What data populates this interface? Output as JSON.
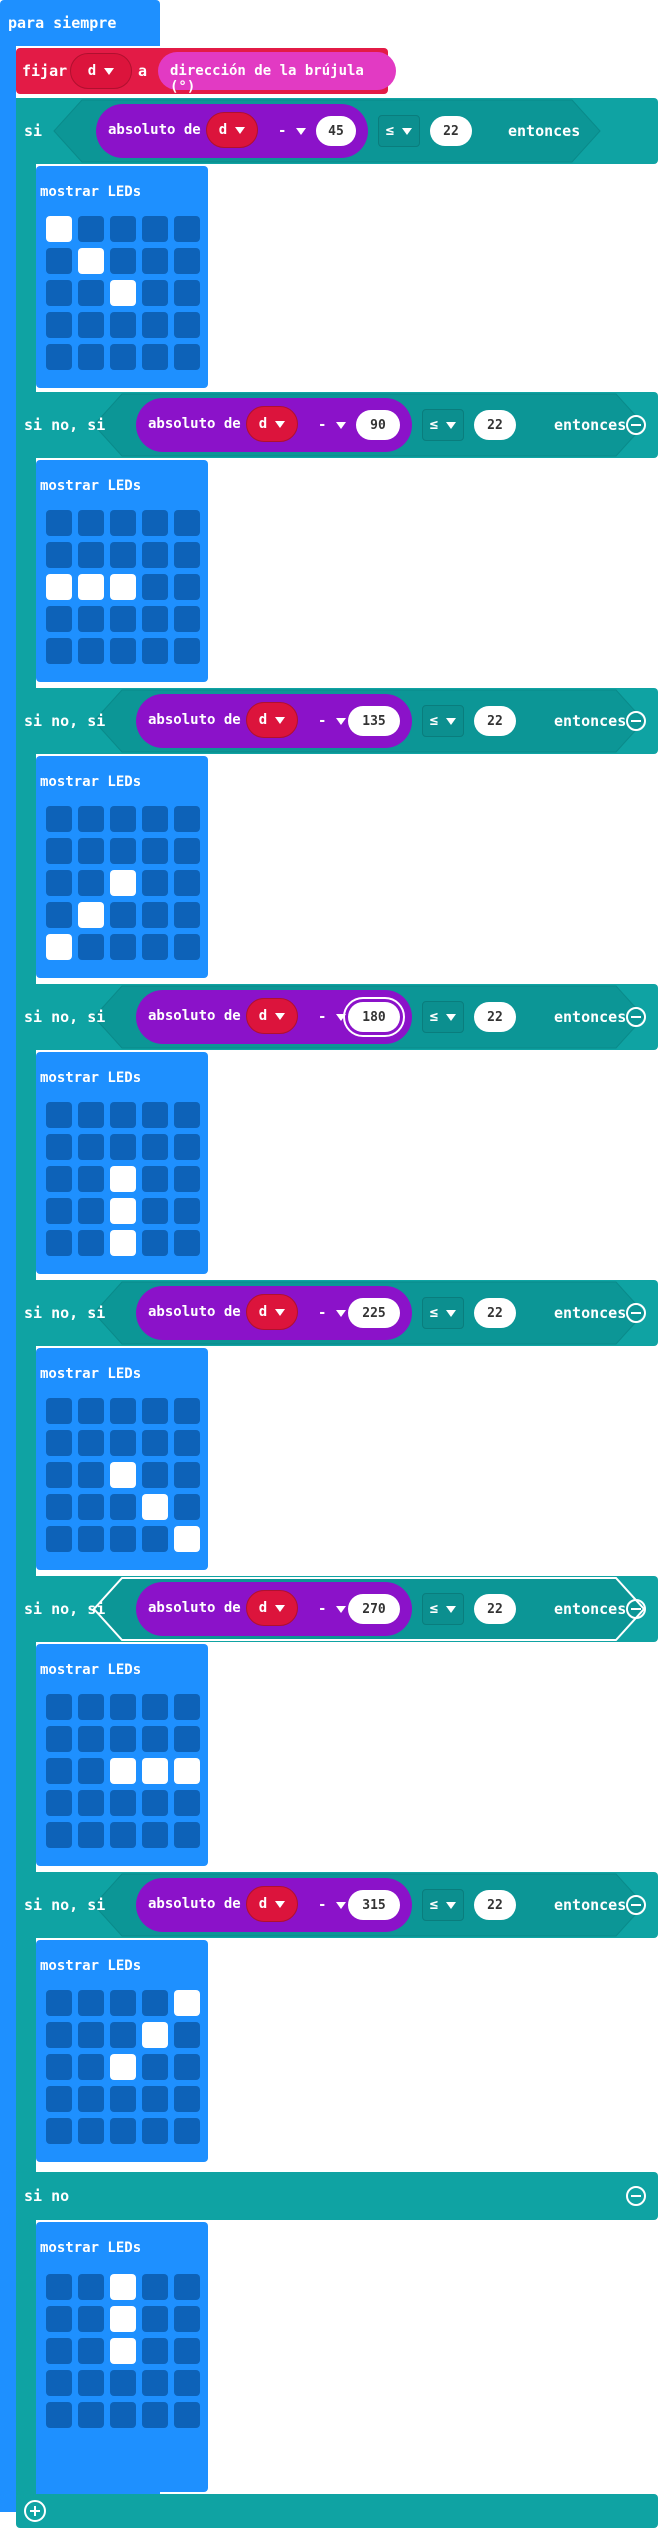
{
  "forever": {
    "label": "para siempre"
  },
  "set_block": {
    "verb": "fijar",
    "variable": "d",
    "to": "a",
    "value": "dirección de la brújula (°)"
  },
  "if_block": {
    "branches": [
      {
        "keyword": "si",
        "abs_label": "absoluto de",
        "variable": "d",
        "op": "-",
        "angle": "45",
        "cmp": "≤",
        "threshold": "22",
        "then": "entonces",
        "led_title": "mostrar LEDs",
        "leds": [
          [
            1,
            0,
            0,
            0,
            0
          ],
          [
            0,
            1,
            0,
            0,
            0
          ],
          [
            0,
            0,
            1,
            0,
            0
          ],
          [
            0,
            0,
            0,
            0,
            0
          ],
          [
            0,
            0,
            0,
            0,
            0
          ]
        ]
      },
      {
        "keyword": "si no, si",
        "abs_label": "absoluto de",
        "variable": "d",
        "op": "-",
        "angle": "90",
        "cmp": "≤",
        "threshold": "22",
        "then": "entonces",
        "led_title": "mostrar LEDs",
        "leds": [
          [
            0,
            0,
            0,
            0,
            0
          ],
          [
            0,
            0,
            0,
            0,
            0
          ],
          [
            1,
            1,
            1,
            0,
            0
          ],
          [
            0,
            0,
            0,
            0,
            0
          ],
          [
            0,
            0,
            0,
            0,
            0
          ]
        ]
      },
      {
        "keyword": "si no, si",
        "abs_label": "absoluto de",
        "variable": "d",
        "op": "-",
        "angle": "135",
        "cmp": "≤",
        "threshold": "22",
        "then": "entonces",
        "led_title": "mostrar LEDs",
        "leds": [
          [
            0,
            0,
            0,
            0,
            0
          ],
          [
            0,
            0,
            0,
            0,
            0
          ],
          [
            0,
            0,
            1,
            0,
            0
          ],
          [
            0,
            1,
            0,
            0,
            0
          ],
          [
            1,
            0,
            0,
            0,
            0
          ]
        ]
      },
      {
        "keyword": "si no, si",
        "abs_label": "absoluto de",
        "variable": "d",
        "op": "-",
        "angle": "180",
        "cmp": "≤",
        "threshold": "22",
        "then": "entonces",
        "led_title": "mostrar LEDs",
        "leds": [
          [
            0,
            0,
            0,
            0,
            0
          ],
          [
            0,
            0,
            0,
            0,
            0
          ],
          [
            0,
            0,
            1,
            0,
            0
          ],
          [
            0,
            0,
            1,
            0,
            0
          ],
          [
            0,
            0,
            1,
            0,
            0
          ]
        ]
      },
      {
        "keyword": "si no, si",
        "abs_label": "absoluto de",
        "variable": "d",
        "op": "-",
        "angle": "225",
        "cmp": "≤",
        "threshold": "22",
        "then": "entonces",
        "led_title": "mostrar LEDs",
        "leds": [
          [
            0,
            0,
            0,
            0,
            0
          ],
          [
            0,
            0,
            0,
            0,
            0
          ],
          [
            0,
            0,
            1,
            0,
            0
          ],
          [
            0,
            0,
            0,
            1,
            0
          ],
          [
            0,
            0,
            0,
            0,
            1
          ]
        ]
      },
      {
        "keyword": "si no, si",
        "abs_label": "absoluto de",
        "variable": "d",
        "op": "-",
        "angle": "270",
        "cmp": "≤",
        "threshold": "22",
        "then": "entonces",
        "led_title": "mostrar LEDs",
        "leds": [
          [
            0,
            0,
            0,
            0,
            0
          ],
          [
            0,
            0,
            0,
            0,
            0
          ],
          [
            0,
            0,
            1,
            1,
            1
          ],
          [
            0,
            0,
            0,
            0,
            0
          ],
          [
            0,
            0,
            0,
            0,
            0
          ]
        ]
      },
      {
        "keyword": "si no, si",
        "abs_label": "absoluto de",
        "variable": "d",
        "op": "-",
        "angle": "315",
        "cmp": "≤",
        "threshold": "22",
        "then": "entonces",
        "led_title": "mostrar LEDs",
        "leds": [
          [
            0,
            0,
            0,
            0,
            1
          ],
          [
            0,
            0,
            0,
            1,
            0
          ],
          [
            0,
            0,
            1,
            0,
            0
          ],
          [
            0,
            0,
            0,
            0,
            0
          ],
          [
            0,
            0,
            0,
            0,
            0
          ]
        ]
      }
    ],
    "else": {
      "keyword": "si no",
      "led_title": "mostrar LEDs",
      "leds": [
        [
          0,
          0,
          1,
          0,
          0
        ],
        [
          0,
          0,
          1,
          0,
          0
        ],
        [
          0,
          0,
          1,
          0,
          0
        ],
        [
          0,
          0,
          0,
          0,
          0
        ],
        [
          0,
          0,
          0,
          0,
          0
        ]
      ]
    },
    "icons": {
      "remove": "minus-circle-icon",
      "add": "plus-circle-icon",
      "dropdown": "caret-down-icon"
    }
  },
  "colors": {
    "loops": "#1e90ff",
    "variables": "#dc143c",
    "logic": "#0fa3a3",
    "math": "#8b12c9",
    "led_on": "#ffffff",
    "led_off": "#0d62b8"
  }
}
